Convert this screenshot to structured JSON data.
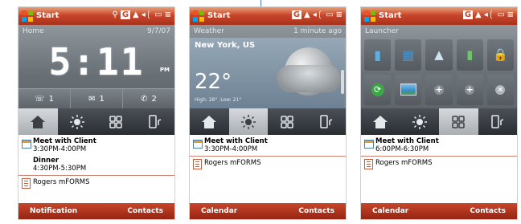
{
  "screens": [
    {
      "statusbar": {
        "start": "Start"
      },
      "panel": {
        "title": "Home",
        "date": "9/7/07",
        "time": "5:11",
        "ampm": "PM",
        "counters": [
          {
            "icon": "voicemail-icon",
            "value": "1"
          },
          {
            "icon": "message-icon",
            "value": "1"
          },
          {
            "icon": "missed-call-icon",
            "value": "2"
          }
        ]
      },
      "appointments": [
        {
          "title": "Meet with Client",
          "time": "3:30PM-4:00PM"
        },
        {
          "title": "Dinner",
          "time": "4:30PM-5:30PM"
        }
      ],
      "task": "Rogers mFORMS",
      "softkeys": {
        "left": "Notification",
        "right": "Contacts"
      },
      "active_tab": 0
    },
    {
      "statusbar": {
        "start": "Start"
      },
      "panel": {
        "title": "Weather",
        "updated": "1 minute ago",
        "city": "New York, US",
        "temp": "22°",
        "high": "High: 28°",
        "low": "Low: 21°"
      },
      "appointments": [
        {
          "title": "Meet with Client",
          "time": "3:30PM-4:00PM"
        }
      ],
      "task": "Rogers mFORMS",
      "softkeys": {
        "left": "Calendar",
        "right": "Contacts"
      },
      "active_tab": 1
    },
    {
      "statusbar": {
        "start": "Start"
      },
      "panel": {
        "title": "Launcher"
      },
      "appointments": [
        {
          "title": "Meet with Client",
          "time": "6:00PM-6:30PM"
        }
      ],
      "task": "Rogers mFORMS",
      "softkeys": {
        "left": "Calendar",
        "right": "Contacts"
      },
      "active_tab": 2
    }
  ],
  "tabs": [
    "home-tab",
    "weather-tab",
    "launcher-tab",
    "settings-tab"
  ],
  "colors": {
    "accent": "#c8462a",
    "panel": "#686f75"
  }
}
